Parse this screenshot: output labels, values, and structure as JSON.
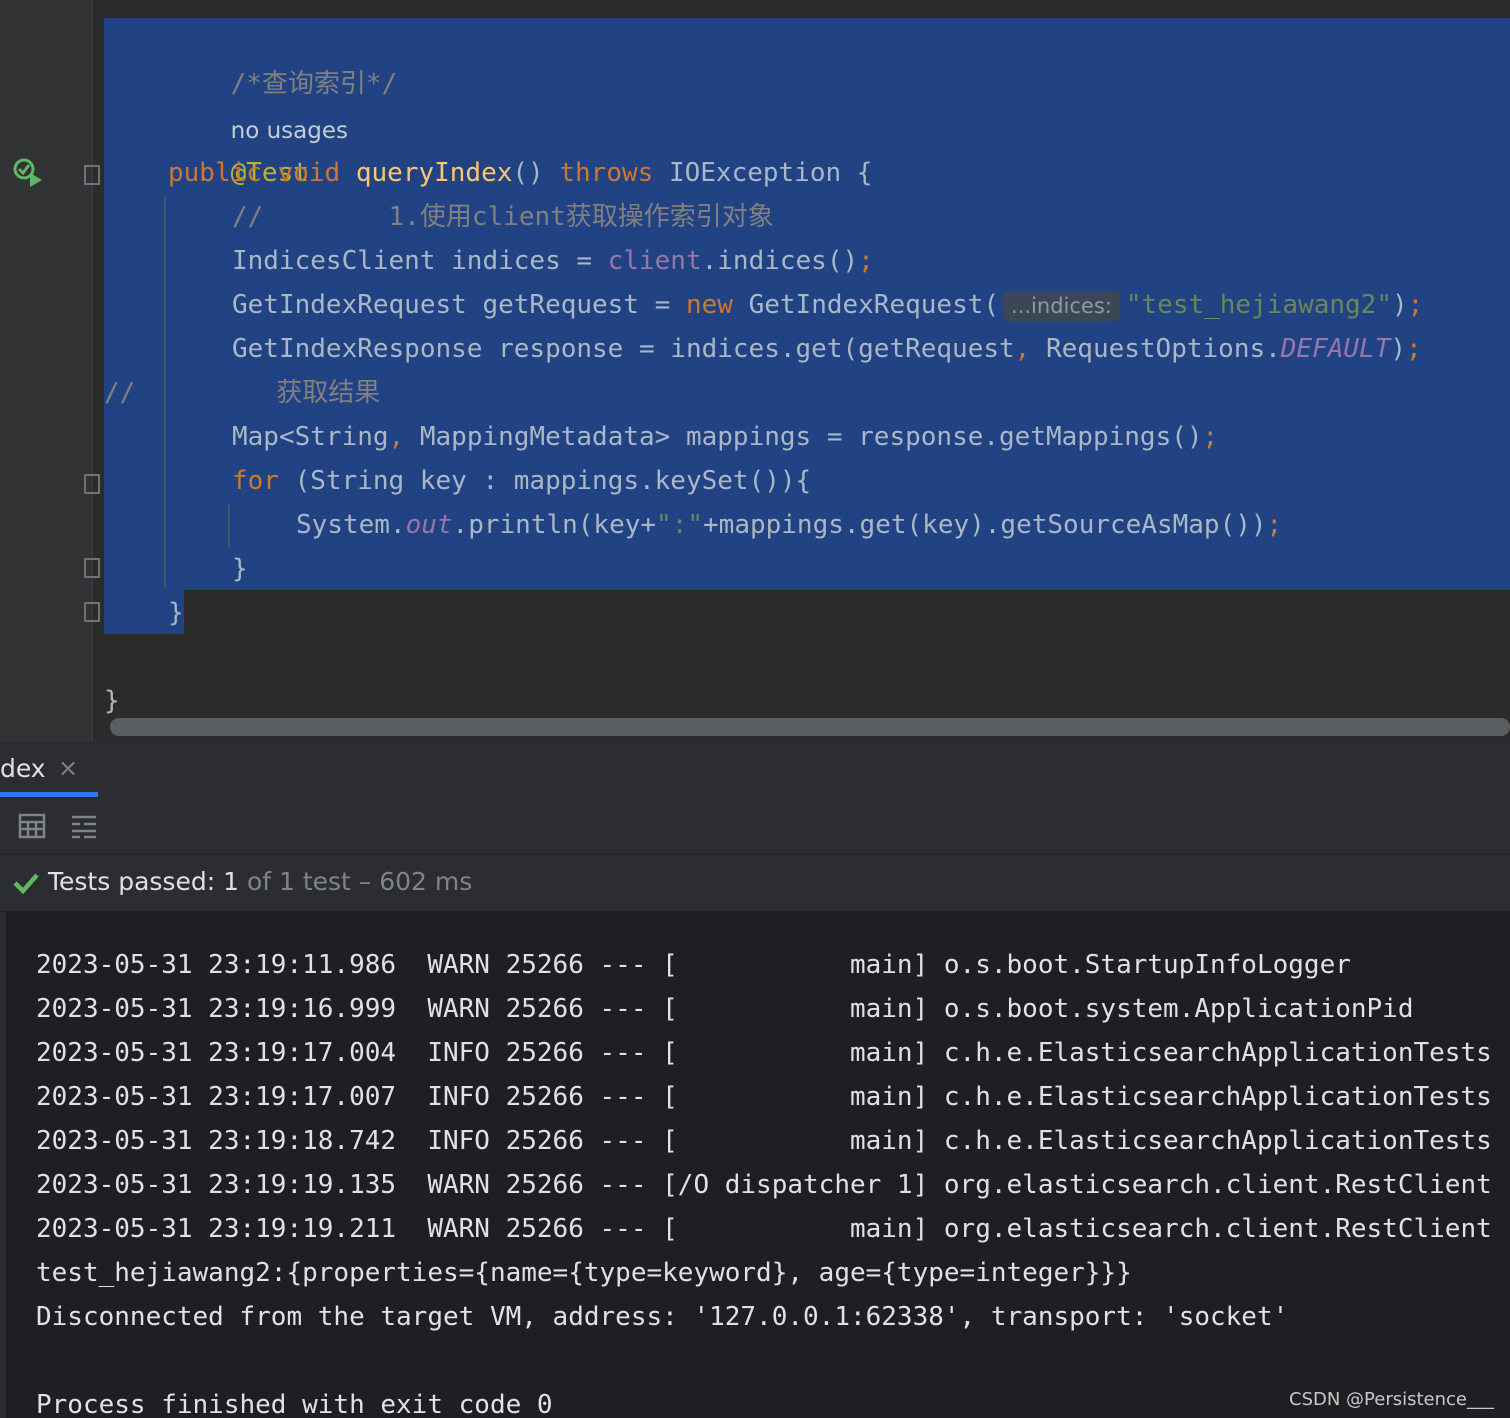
{
  "editor": {
    "lines": {
      "comment_header": "/*查询索引*/",
      "usages": "no usages",
      "annotation": "@Test",
      "sig_public": "public",
      "sig_void": "void",
      "sig_name": "queryIndex",
      "sig_parens": "()",
      "sig_throws": "throws",
      "sig_exc": "IOException {",
      "c1_slashes": "//",
      "c1_text": "1.使用client获取操作索引对象",
      "l_indices_a": "IndicesClient indices = ",
      "l_indices_b": "client",
      "l_indices_c": ".indices()",
      "semi": ";",
      "l_req_a": "GetIndexRequest getRequest = ",
      "l_req_new": "new",
      "l_req_b": " GetIndexRequest(",
      "l_req_hint": "...indices:",
      "l_req_str": "\"test_hejiawang2\"",
      "l_req_c": ")",
      "l_resp_a": "GetIndexResponse response = indices.get(getRequest",
      "comma": ",",
      "l_resp_b": " RequestOptions.",
      "l_resp_const": "DEFAULT",
      "l_resp_c": ")",
      "c2_slashes": "//",
      "c2_text": "获取结果",
      "l_map_a": "Map<String",
      "l_map_b": " MappingMetadata> mappings = response.getMappings()",
      "l_for_kw": "for",
      "l_for_b": " (String key : mappings.keySet()){",
      "l_print_a": "System.",
      "l_print_out": "out",
      "l_print_b": ".println(key+",
      "l_print_str": "\":\"",
      "l_print_c": "+mappings.get(key).getSourceAsMap())",
      "close_for": "}",
      "close_method": "}",
      "close_class": "}"
    }
  },
  "tool_window": {
    "tab_label": "dex",
    "tab_close": "×",
    "status": {
      "passed_label": "Tests passed:",
      "passed_count": "1",
      "of_text": "of 1 test – 602 ms"
    },
    "icons": [
      "table-icon",
      "list-tree-icon",
      "check-icon",
      "run-test-icon"
    ]
  },
  "console": {
    "lines": [
      "2023-05-31 23:19:11.986  WARN 25266 --- [           main] o.s.boot.StartupInfoLogger",
      "2023-05-31 23:19:16.999  WARN 25266 --- [           main] o.s.boot.system.ApplicationPid",
      "2023-05-31 23:19:17.004  INFO 25266 --- [           main] c.h.e.ElasticsearchApplicationTests",
      "2023-05-31 23:19:17.007  INFO 25266 --- [           main] c.h.e.ElasticsearchApplicationTests",
      "2023-05-31 23:19:18.742  INFO 25266 --- [           main] c.h.e.ElasticsearchApplicationTests",
      "2023-05-31 23:19:19.135  WARN 25266 --- [/O dispatcher 1] org.elasticsearch.client.RestClient",
      "2023-05-31 23:19:19.211  WARN 25266 --- [           main] org.elasticsearch.client.RestClient",
      "test_hejiawang2:{properties={name={type=keyword}, age={type=integer}}}",
      "Disconnected from the target VM, address: '127.0.0.1:62338', transport: 'socket'",
      "",
      "Process finished with exit code 0"
    ]
  },
  "watermark": "CSDN @Persistence___",
  "colors": {
    "selection": "#214283",
    "keyword": "#cc7832",
    "function": "#ffc66d",
    "string": "#6a8759",
    "field": "#9876aa",
    "pass_green": "#5fb865"
  }
}
